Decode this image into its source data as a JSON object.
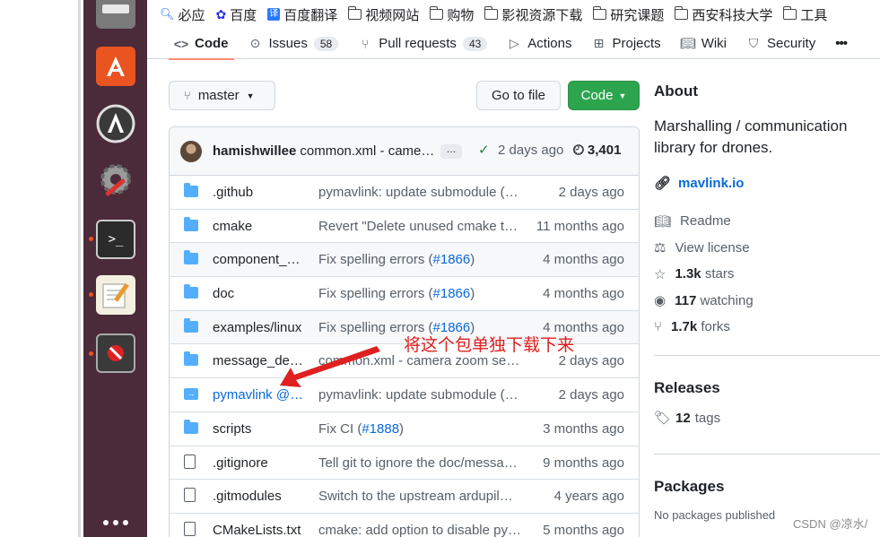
{
  "bookmarks": [
    {
      "label": "必应",
      "icon": "search-icon"
    },
    {
      "label": "百度",
      "icon": "baidu-paw-icon"
    },
    {
      "label": "百度翻译",
      "icon": "translate-icon"
    },
    {
      "label": "视频网站",
      "icon": "folder-icon"
    },
    {
      "label": "购物",
      "icon": "folder-icon"
    },
    {
      "label": "影视资源下载",
      "icon": "folder-icon"
    },
    {
      "label": "研究课题",
      "icon": "folder-icon"
    },
    {
      "label": "西安科技大学",
      "icon": "folder-icon"
    },
    {
      "label": "工具",
      "icon": "folder-icon"
    }
  ],
  "tabs": {
    "code": "Code",
    "issues": "Issues",
    "issues_count": "58",
    "pulls": "Pull requests",
    "pulls_count": "43",
    "actions": "Actions",
    "projects": "Projects",
    "wiki": "Wiki",
    "security": "Security",
    "more": "•••"
  },
  "toolbar": {
    "branch": "master",
    "go_to_file": "Go to file",
    "code": "Code"
  },
  "commit": {
    "author": "hamishwillee",
    "message": "common.xml - came…",
    "ellipsis": "…",
    "time": "2 days ago",
    "count": "3,401"
  },
  "files": [
    {
      "type": "dir",
      "name": ".github",
      "msg": "pymavlink: update submodule (…",
      "link": "",
      "msg_tail": "",
      "age": "2 days ago"
    },
    {
      "type": "dir",
      "name": "cmake",
      "msg": "Revert \"Delete unused cmake tr…",
      "link": "",
      "msg_tail": "",
      "age": "11 months ago"
    },
    {
      "type": "dir",
      "name": "component_…",
      "msg": "Fix spelling errors (",
      "link": "#1866",
      "msg_tail": ")",
      "age": "4 months ago"
    },
    {
      "type": "dir",
      "name": "doc",
      "msg": "Fix spelling errors (",
      "link": "#1866",
      "msg_tail": ")",
      "age": "4 months ago"
    },
    {
      "type": "dir",
      "name": "examples/linux",
      "msg": "Fix spelling errors (",
      "link": "#1866",
      "msg_tail": ")",
      "age": "4 months ago"
    },
    {
      "type": "dir",
      "name": "message_def…",
      "msg": "common.xml - camera zoom set…",
      "link": "",
      "msg_tail": "",
      "age": "2 days ago"
    },
    {
      "type": "sub",
      "name": "pymavlink @…",
      "msg": "pymavlink: update submodule (…",
      "link": "",
      "msg_tail": "",
      "age": "2 days ago"
    },
    {
      "type": "dir",
      "name": "scripts",
      "msg": "Fix CI (",
      "link": "#1888",
      "msg_tail": ")",
      "age": "3 months ago"
    },
    {
      "type": "file",
      "name": ".gitignore",
      "msg": "Tell git to ignore the doc/messa…",
      "link": "",
      "msg_tail": "",
      "age": "9 months ago"
    },
    {
      "type": "file",
      "name": ".gitmodules",
      "msg": "Switch to the upstream ardupil…",
      "link": "",
      "msg_tail": "",
      "age": "4 years ago"
    },
    {
      "type": "file",
      "name": "CMakeLists.txt",
      "msg": "cmake: add option to disable py…",
      "link": "",
      "msg_tail": "",
      "age": "5 months ago"
    }
  ],
  "about": {
    "title": "About",
    "description": "Marshalling / communication library for drones.",
    "website": "mavlink.io",
    "readme": "Readme",
    "license": "View license",
    "stars_count": "1.3k",
    "stars_label": "stars",
    "watching_count": "117",
    "watching_label": "watching",
    "forks_count": "1.7k",
    "forks_label": "forks"
  },
  "releases": {
    "title": "Releases",
    "tags_count": "12",
    "tags_label": "tags"
  },
  "packages": {
    "title": "Packages",
    "none": "No packages published"
  },
  "annotation": {
    "text": "将这个包单独下载下来",
    "color": "#e02020"
  },
  "watermark": "CSDN @凉水/",
  "colors": {
    "accent_green": "#2da44e",
    "link_blue": "#0969da",
    "folder_blue": "#54aeff",
    "dock": "#4b2a3a",
    "active_tab_underline": "#fd8c73"
  }
}
